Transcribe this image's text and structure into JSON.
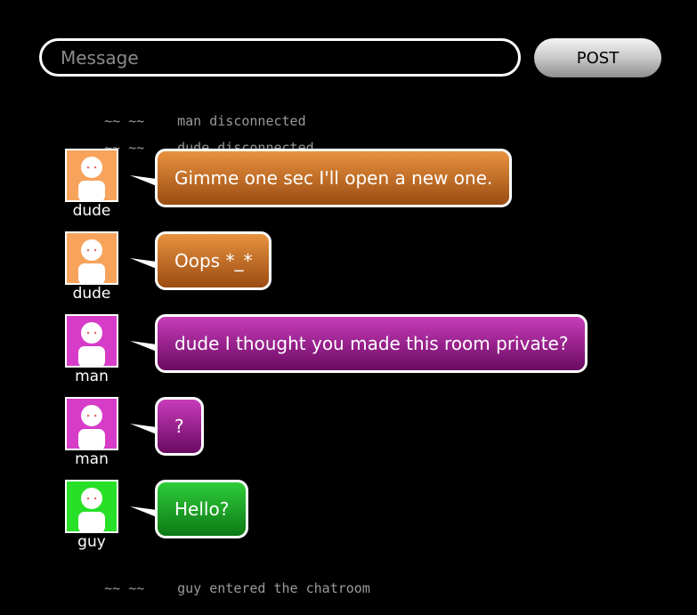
{
  "composer": {
    "placeholder": "Message",
    "post_label": "POST"
  },
  "colors": {
    "dude": "#f7a35c",
    "dude_bubble_top": "#e8923f",
    "dude_bubble_bottom": "#9a4c12",
    "man": "#d63cc8",
    "man_bubble_top": "#c83cba",
    "man_bubble_bottom": "#6a0a62",
    "guy": "#28e028",
    "guy_bubble_top": "#2ecc3a",
    "guy_bubble_bottom": "#0e7a16"
  },
  "feed": {
    "system_top_1": {
      "prefix": "~~ ~~",
      "text": "man disconnected"
    },
    "system_top_2": {
      "prefix": "~~ ~~",
      "text": "dude disconnected"
    },
    "messages": [
      {
        "user": "dude",
        "text": "Gimme one sec I'll open a new one."
      },
      {
        "user": "dude",
        "text": "Oops *_*"
      },
      {
        "user": "man",
        "text": "dude I thought you made this room private?"
      },
      {
        "user": "man",
        "text": "?"
      },
      {
        "user": "guy",
        "text": "Hello?"
      }
    ],
    "system_bottom": {
      "prefix": "~~ ~~",
      "text": "guy entered the chatroom"
    }
  }
}
